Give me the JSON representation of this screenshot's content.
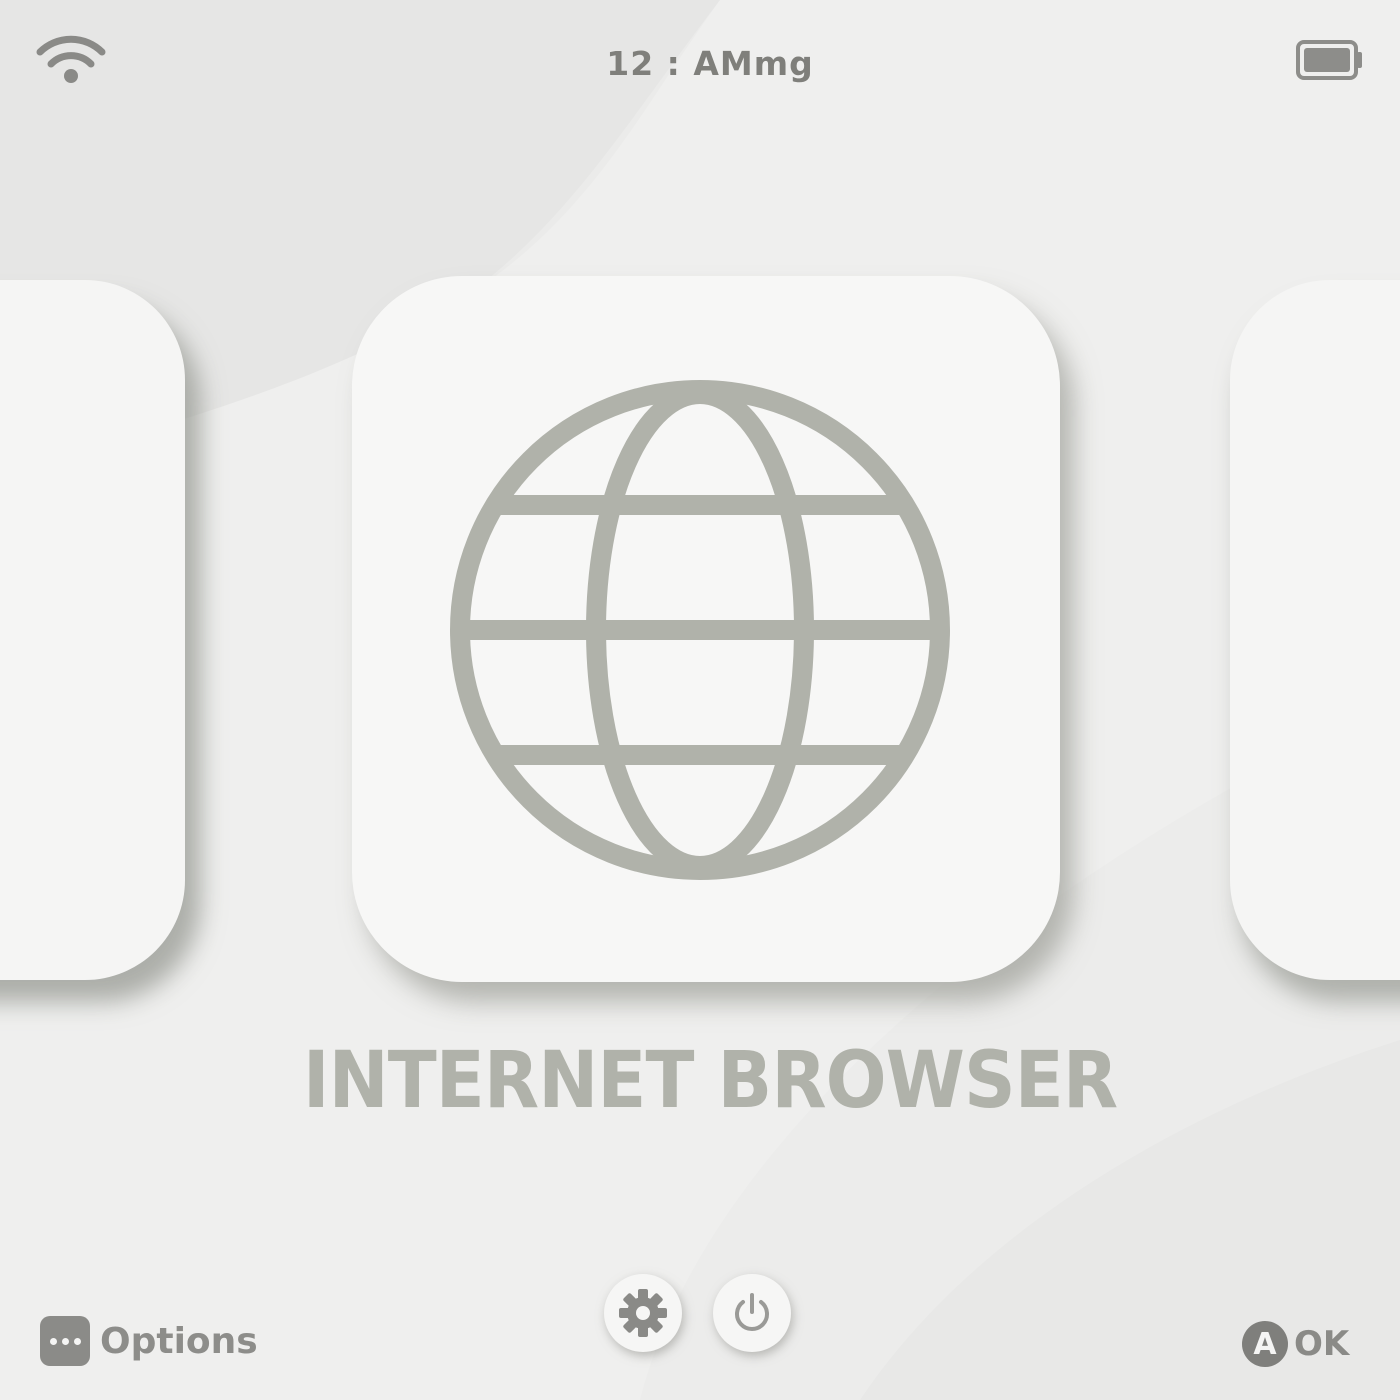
{
  "status_bar": {
    "time": "12 : AMmg",
    "wifi_icon": "wifi-icon",
    "battery_icon": "battery-icon"
  },
  "carousel": {
    "selected_app": {
      "title": "INTERNET BROWSER",
      "icon": "globe-icon"
    }
  },
  "footer": {
    "options_label": "Options",
    "options_icon": "ellipsis-icon",
    "settings_icon": "gear-icon",
    "power_icon": "power-icon",
    "confirm_badge": "A",
    "confirm_label": "OK"
  },
  "colors": {
    "background": "#ececeb",
    "tile": "#f7f7f6",
    "icon_gray": "#b0b2aa",
    "text_gray": "#8d8d8a"
  }
}
